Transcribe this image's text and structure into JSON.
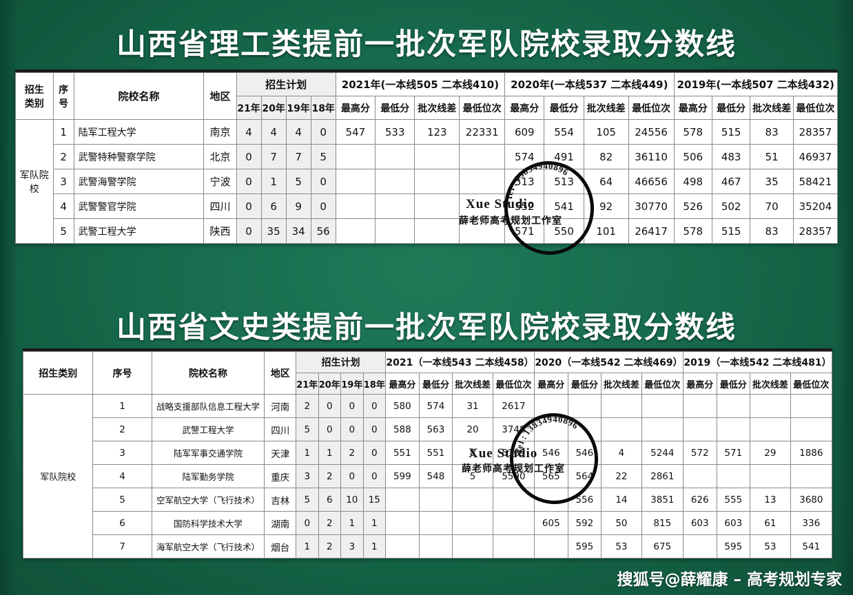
{
  "theme": {
    "background_green": "#176b4c",
    "banner_text_color": "#ffffff",
    "accent_line": "#32c183",
    "plan_cell_bg": "#efefef"
  },
  "banner1": {
    "title": "山西省理工类提前一批次军队院校录取分数线"
  },
  "banner2": {
    "title": "山西省文史类提前一批次军队院校录取分数线"
  },
  "footer": {
    "credit": "搜狐号@薛耀康 – 高考规划专家"
  },
  "watermark": {
    "brand": "Xue Studio",
    "sub": "薛老师高考规划工作室",
    "tel": "Tel:13834940896"
  },
  "table1": {
    "headers": {
      "category": "招生\n类别",
      "category_l1": "招生",
      "category_l2": "类别",
      "index_l1": "序",
      "index_l2": "号",
      "school": "院校名称",
      "region": "地区",
      "plan": "招生计划",
      "plan_years": [
        "21年",
        "20年",
        "19年",
        "18年"
      ],
      "year_groups": [
        "2021年(一本线505 二本线410)",
        "2020年(一本线537 二本线449)",
        "2019年(一本线507 二本线432)"
      ],
      "metrics": [
        "最高分",
        "最低分",
        "批次线差",
        "最低位次"
      ]
    },
    "category_label": "军队院校",
    "rows": [
      {
        "index": "1",
        "school": "陆军工程大学",
        "region": "南京",
        "plan": [
          "4",
          "4",
          "4",
          "0"
        ],
        "y2021": [
          "547",
          "533",
          "123",
          "22331"
        ],
        "y2020": [
          "609",
          "554",
          "105",
          "24556"
        ],
        "y2019": [
          "578",
          "515",
          "83",
          "28357"
        ]
      },
      {
        "index": "2",
        "school": "武警特种警察学院",
        "region": "北京",
        "plan": [
          "0",
          "7",
          "7",
          "5"
        ],
        "y2021": [
          "",
          "",
          "",
          ""
        ],
        "y2020": [
          "574",
          "491",
          "82",
          "36110"
        ],
        "y2019": [
          "506",
          "483",
          "51",
          "46937"
        ]
      },
      {
        "index": "3",
        "school": "武警海警学院",
        "region": "宁波",
        "plan": [
          "0",
          "1",
          "5",
          "0"
        ],
        "y2021": [
          "",
          "",
          "",
          ""
        ],
        "y2020": [
          "513",
          "513",
          "64",
          "46656"
        ],
        "y2019": [
          "498",
          "467",
          "35",
          "58421"
        ]
      },
      {
        "index": "4",
        "school": "武警警官学院",
        "region": "四川",
        "plan": [
          "0",
          "6",
          "9",
          "0"
        ],
        "y2021": [
          "",
          "",
          "",
          ""
        ],
        "y2020": [
          "552",
          "541",
          "92",
          "30770"
        ],
        "y2019": [
          "526",
          "502",
          "70",
          "35204"
        ]
      },
      {
        "index": "5",
        "school": "武警工程大学",
        "region": "陕西",
        "plan": [
          "0",
          "35",
          "34",
          "56"
        ],
        "y2021": [
          "",
          "",
          "",
          ""
        ],
        "y2020": [
          "571",
          "550",
          "101",
          "26417"
        ],
        "y2019": [
          "578",
          "515",
          "83",
          "28357"
        ]
      }
    ]
  },
  "table2": {
    "headers": {
      "category": "招生类别",
      "index": "序号",
      "school": "院校名称",
      "region": "地区",
      "plan": "招生计划",
      "plan_years": [
        "21年",
        "20年",
        "19年",
        "18年"
      ],
      "year_groups": [
        "2021（一本线543 二本线458）",
        "2020（一本线542 二本线469）",
        "2019（一本线542 二本线481）"
      ],
      "metrics": [
        "最高分",
        "最低分",
        "批次线差",
        "最低位次"
      ]
    },
    "category_label": "军队院校",
    "rows": [
      {
        "index": "1",
        "school": "战略支援部队信息工程大学",
        "region": "河南",
        "plan": [
          "2",
          "0",
          "0",
          "0"
        ],
        "y2021": [
          "580",
          "574",
          "31",
          "2617"
        ],
        "y2020": [
          "",
          "",
          "",
          ""
        ],
        "y2019": [
          "",
          "",
          "",
          ""
        ]
      },
      {
        "index": "2",
        "school": "武警工程大学",
        "region": "四川",
        "plan": [
          "5",
          "0",
          "0",
          "0"
        ],
        "y2021": [
          "588",
          "563",
          "20",
          "3748"
        ],
        "y2020": [
          "",
          "",
          "",
          ""
        ],
        "y2019": [
          "",
          "",
          "",
          ""
        ]
      },
      {
        "index": "3",
        "school": "陆军军事交通学院",
        "region": "天津",
        "plan": [
          "1",
          "1",
          "2",
          "0"
        ],
        "y2021": [
          "551",
          "551",
          "8",
          "5169"
        ],
        "y2020": [
          "546",
          "546",
          "4",
          "5244"
        ],
        "y2019": [
          "572",
          "571",
          "29",
          "1886"
        ]
      },
      {
        "index": "4",
        "school": "陆军勤务学院",
        "region": "重庆",
        "plan": [
          "3",
          "2",
          "0",
          "0"
        ],
        "y2021": [
          "599",
          "548",
          "5",
          "5590"
        ],
        "y2020": [
          "565",
          "564",
          "22",
          "2861"
        ],
        "y2019": [
          "",
          "",
          "",
          ""
        ]
      },
      {
        "index": "5",
        "school": "空军航空大学（飞行技术）",
        "region": "吉林",
        "plan": [
          "5",
          "6",
          "10",
          "15"
        ],
        "y2021": [
          "",
          "",
          "",
          ""
        ],
        "y2020": [
          "",
          "556",
          "14",
          "3851"
        ],
        "y2019": [
          "626",
          "555",
          "13",
          "3680"
        ]
      },
      {
        "index": "6",
        "school": "国防科学技术大学",
        "region": "湖南",
        "plan": [
          "0",
          "2",
          "1",
          "1"
        ],
        "y2021": [
          "",
          "",
          "",
          ""
        ],
        "y2020": [
          "605",
          "592",
          "50",
          "815"
        ],
        "y2019": [
          "603",
          "603",
          "61",
          "336"
        ]
      },
      {
        "index": "7",
        "school": "海军航空大学（飞行技术）",
        "region": "烟台",
        "plan": [
          "1",
          "2",
          "3",
          "1"
        ],
        "y2021": [
          "",
          "",
          "",
          ""
        ],
        "y2020": [
          "",
          "595",
          "53",
          "675"
        ],
        "y2019": [
          "",
          "595",
          "53",
          "541"
        ]
      }
    ]
  }
}
